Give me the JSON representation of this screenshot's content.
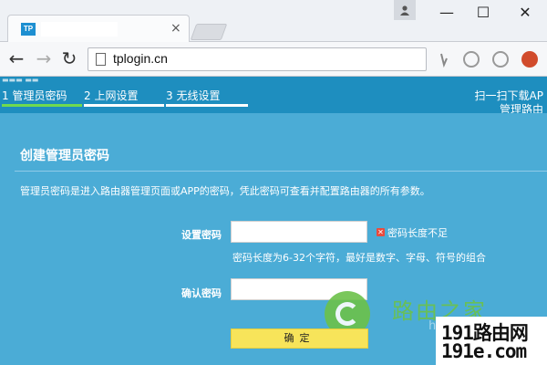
{
  "browser": {
    "tab_logo": "TP",
    "tab_close": "×",
    "window_controls": {
      "minimize": "—",
      "maximize": "☐",
      "close": "✕"
    },
    "nav": {
      "back": "←",
      "forward": "→",
      "reload": "↻"
    },
    "address": "tplogin.cn"
  },
  "pagenav": {
    "steps": [
      {
        "label": "1 管理员密码",
        "active": true
      },
      {
        "label": "2 上网设置",
        "active": false
      },
      {
        "label": "3 无线设置",
        "active": false
      }
    ],
    "download_line1": "扫一扫下载AP",
    "download_line2": "管理路由"
  },
  "form": {
    "title": "创建管理员密码",
    "description": "管理员密码是进入路由器管理页面或APP的密码，凭此密码可查看并配置路由器的所有参数。",
    "password_label": "设置密码",
    "password_value": "",
    "error_icon": "✕",
    "error_text": "密码长度不足",
    "hint": "密码长度为6-32个字符，最好是数字、字母、符号的组合",
    "confirm_label": "确认密码",
    "confirm_value": "",
    "submit": "确定"
  },
  "watermark": {
    "brand": "路由之家",
    "url_fragment": "h",
    "badge_line1": "191路由网",
    "badge_line2": "191e.com"
  },
  "colors": {
    "page_bg": "#4bacd6",
    "nav_bg": "#1e8ebf",
    "active_step": "#6fda4f",
    "confirm_button": "#f7e45a",
    "error": "#e94a3d"
  }
}
